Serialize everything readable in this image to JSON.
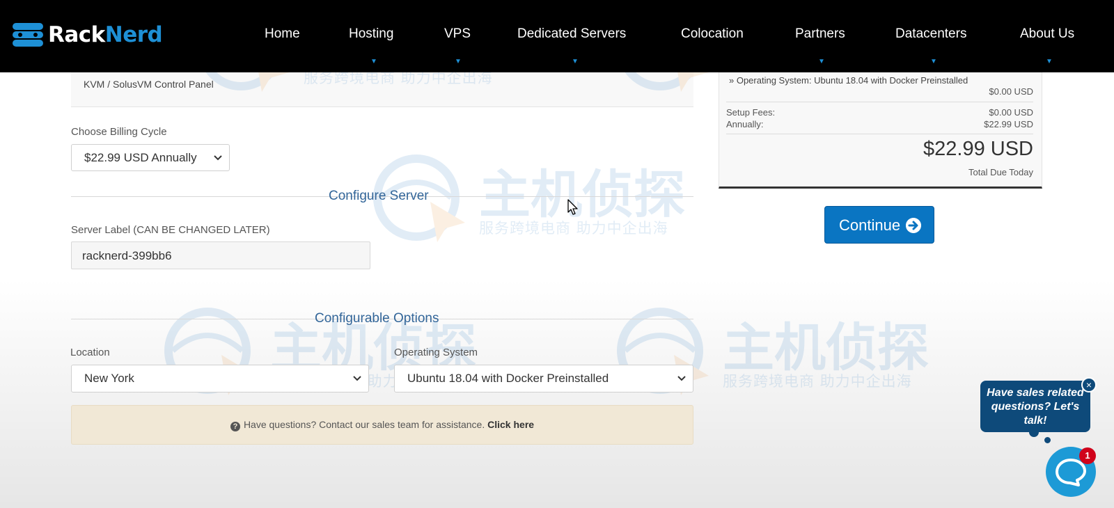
{
  "brand": {
    "part1": "Rack",
    "part2": "Nerd"
  },
  "nav": {
    "items": [
      {
        "label": "Home",
        "has_dropdown": false
      },
      {
        "label": "Hosting",
        "has_dropdown": true
      },
      {
        "label": "VPS",
        "has_dropdown": true
      },
      {
        "label": "Dedicated Servers",
        "has_dropdown": true
      },
      {
        "label": "Colocation",
        "has_dropdown": false
      },
      {
        "label": "Partners",
        "has_dropdown": true
      },
      {
        "label": "Datacenters",
        "has_dropdown": true
      },
      {
        "label": "About Us",
        "has_dropdown": true
      }
    ]
  },
  "product": {
    "control_panel": "KVM / SolusVM Control Panel"
  },
  "billing": {
    "label": "Choose Billing Cycle",
    "selected": "$22.99 USD Annually"
  },
  "configure_server": {
    "heading": "Configure Server",
    "server_label_caption": "Server Label (CAN BE CHANGED LATER)",
    "server_label_value": "racknerd-399bb6"
  },
  "configurable_options": {
    "heading": "Configurable Options",
    "location_label": "Location",
    "location_value": "New York",
    "os_label": "Operating System",
    "os_value": "Ubuntu 18.04 with Docker Preinstalled"
  },
  "help": {
    "text": "Have questions? Contact our sales team for assistance.",
    "link": "Click here"
  },
  "summary": {
    "os_line": "» Operating System: Ubuntu 18.04 with Docker Preinstalled",
    "os_price": "$0.00 USD",
    "setup_label": "Setup Fees:",
    "setup_value": "$0.00 USD",
    "annual_label": "Annually:",
    "annual_value": "$22.99 USD",
    "total": "$22.99 USD",
    "total_caption": "Total Due Today"
  },
  "continue_label": "Continue",
  "chat": {
    "bubble_text": "Have sales related questions? Let's talk!",
    "badge_count": "1",
    "close_symbol": "×"
  },
  "watermark": {
    "text": "主机侦探",
    "subtext": "服务跨境电商 助力中企出海"
  },
  "colors": {
    "brand_blue": "#1e90d6",
    "button_blue": "#0a75c2",
    "chat_navy": "#0e4a7a",
    "help_bg": "#f1e8d6",
    "badge_red": "#d0021b"
  }
}
